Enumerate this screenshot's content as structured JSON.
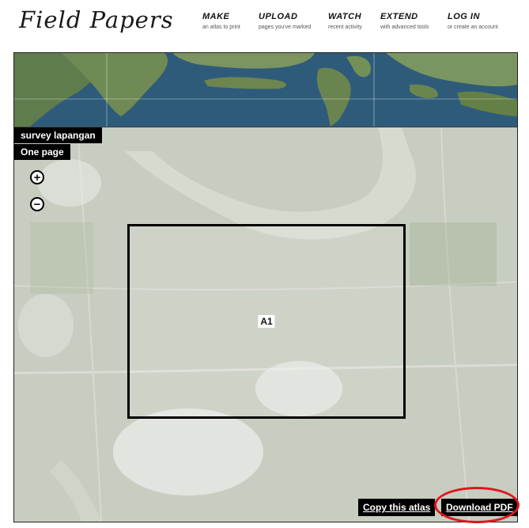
{
  "header": {
    "logo": "Field Papers",
    "nav": [
      {
        "title": "MAKE",
        "subtitle": "an atlas to print"
      },
      {
        "title": "UPLOAD",
        "subtitle": "pages you've marked"
      },
      {
        "title": "WATCH",
        "subtitle": "recent activity"
      },
      {
        "title": "EXTEND",
        "subtitle": "with advanced tools"
      },
      {
        "title": "LOG IN",
        "subtitle": "or create an account"
      }
    ]
  },
  "map": {
    "atlas_title": "survey lapangan",
    "page_count": "One page",
    "zoom_in": "+",
    "zoom_out": "−",
    "page_label": "A1"
  },
  "actions": {
    "copy_atlas": "Copy this atlas",
    "download_pdf": "Download PDF"
  },
  "colors": {
    "highlight": "#e0151d",
    "ocean": "#2f5b7a",
    "land": "#6f8a54"
  }
}
